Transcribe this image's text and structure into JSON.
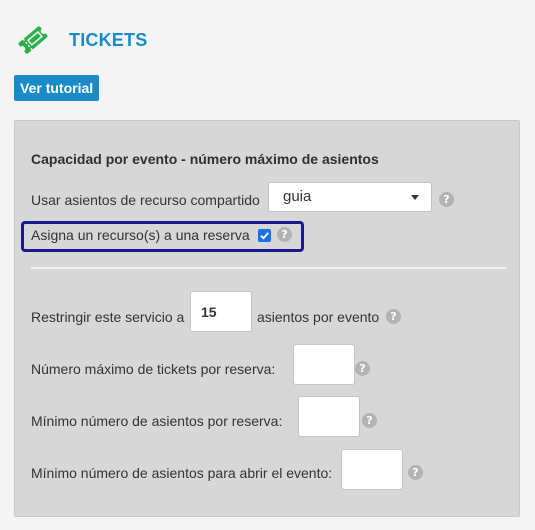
{
  "header": {
    "title": "TICKETS",
    "icon": "ticket-icon",
    "tutorial_label": "Ver tutorial"
  },
  "colors": {
    "accent": "#1a8bc9",
    "icon_green": "#2ab24a",
    "highlight_border": "#1a1a8c"
  },
  "panel": {
    "title": "Capacidad por evento - número máximo de asientos",
    "shared_seats": {
      "label": "Usar asientos de recurso compartido",
      "selected": "guia"
    },
    "assign_resource": {
      "label": "Asigna un recurso(s) a una reserva",
      "checked": true
    },
    "restrict": {
      "label_before": "Restringir este servicio a",
      "value": "15",
      "label_after": "asientos por evento"
    },
    "max_tickets": {
      "label": "Número máximo de tickets por reserva:",
      "value": ""
    },
    "min_seats": {
      "label": "Mínimo número de asientos por reserva:",
      "value": ""
    },
    "min_open": {
      "label": "Mínimo número de asientos para abrir el evento:",
      "value": ""
    },
    "help_glyph": "?"
  }
}
